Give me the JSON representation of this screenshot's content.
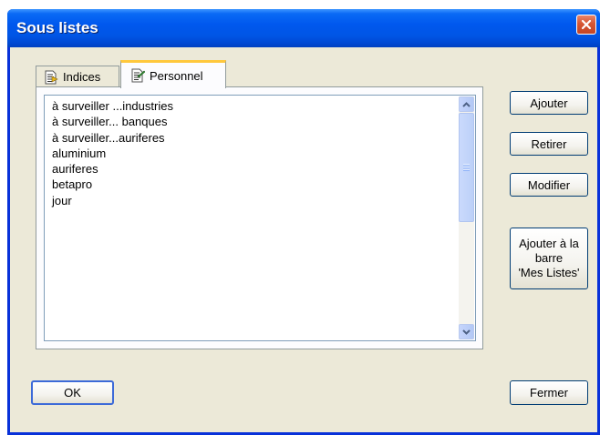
{
  "window": {
    "title": "Sous listes"
  },
  "tabs": [
    {
      "label": "Indices",
      "icon": "document-list-icon",
      "selected": false
    },
    {
      "label": "Personnel",
      "icon": "document-edit-icon",
      "selected": true
    }
  ],
  "list": {
    "items": [
      "à surveiller ...industries",
      "à surveiller... banques",
      "à surveiller...auriferes",
      "aluminium",
      "auriferes",
      "betapro",
      "jour"
    ]
  },
  "buttons": {
    "ajouter": "Ajouter",
    "retirer": "Retirer",
    "modifier": "Modifier",
    "barre_line1": "Ajouter à la",
    "barre_line2": "barre",
    "barre_line3": "'Mes Listes'",
    "ok": "OK",
    "fermer": "Fermer"
  },
  "colors": {
    "titlebar": "#0055E5",
    "dialog_bg": "#ECE9D8",
    "close_button": "#D65633",
    "active_tab_accent": "#FFC83C"
  }
}
